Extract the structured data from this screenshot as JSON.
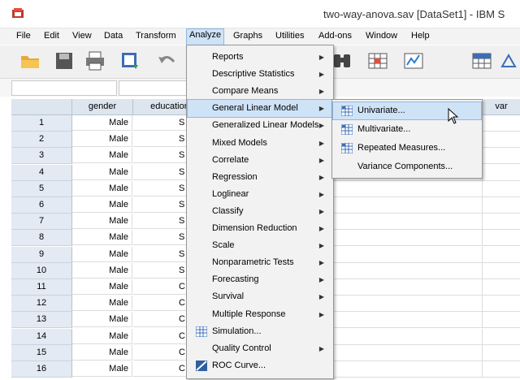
{
  "window": {
    "title": "two-way-anova.sav [DataSet1] - IBM S"
  },
  "menubar": [
    "File",
    "Edit",
    "View",
    "Data",
    "Transform",
    "Analyze",
    "Graphs",
    "Utilities",
    "Add-ons",
    "Window",
    "Help"
  ],
  "grid": {
    "columns": [
      "gender",
      "education",
      "var"
    ],
    "rows": [
      {
        "n": "1",
        "gender": "Male",
        "education": "S"
      },
      {
        "n": "2",
        "gender": "Male",
        "education": "S"
      },
      {
        "n": "3",
        "gender": "Male",
        "education": "S"
      },
      {
        "n": "4",
        "gender": "Male",
        "education": "S"
      },
      {
        "n": "5",
        "gender": "Male",
        "education": "S"
      },
      {
        "n": "6",
        "gender": "Male",
        "education": "S"
      },
      {
        "n": "7",
        "gender": "Male",
        "education": "S"
      },
      {
        "n": "8",
        "gender": "Male",
        "education": "S"
      },
      {
        "n": "9",
        "gender": "Male",
        "education": "S"
      },
      {
        "n": "10",
        "gender": "Male",
        "education": "S"
      },
      {
        "n": "11",
        "gender": "Male",
        "education": "C"
      },
      {
        "n": "12",
        "gender": "Male",
        "education": "C"
      },
      {
        "n": "13",
        "gender": "Male",
        "education": "C"
      },
      {
        "n": "14",
        "gender": "Male",
        "education": "C"
      },
      {
        "n": "15",
        "gender": "Male",
        "education": "C"
      },
      {
        "n": "16",
        "gender": "Male",
        "education": "C"
      }
    ]
  },
  "analyze_menu": [
    {
      "label": "Reports",
      "submenu": true
    },
    {
      "label": "Descriptive Statistics",
      "submenu": true
    },
    {
      "label": "Compare Means",
      "submenu": true
    },
    {
      "label": "General Linear Model",
      "submenu": true,
      "highlighted": true
    },
    {
      "label": "Generalized Linear Models",
      "submenu": true
    },
    {
      "label": "Mixed Models",
      "submenu": true
    },
    {
      "label": "Correlate",
      "submenu": true
    },
    {
      "label": "Regression",
      "submenu": true
    },
    {
      "label": "Loglinear",
      "submenu": true
    },
    {
      "label": "Classify",
      "submenu": true
    },
    {
      "label": "Dimension Reduction",
      "submenu": true
    },
    {
      "label": "Scale",
      "submenu": true
    },
    {
      "label": "Nonparametric Tests",
      "submenu": true
    },
    {
      "label": "Forecasting",
      "submenu": true
    },
    {
      "label": "Survival",
      "submenu": true
    },
    {
      "label": "Multiple Response",
      "submenu": true
    },
    {
      "label": "Simulation...",
      "submenu": false,
      "icon": "simulation-icon"
    },
    {
      "label": "Quality Control",
      "submenu": true
    },
    {
      "label": "ROC Curve...",
      "submenu": false,
      "icon": "roc-curve-icon"
    }
  ],
  "glm_submenu": [
    {
      "label": "Univariate...",
      "icon": "univariate-icon",
      "highlighted": true
    },
    {
      "label": "Multivariate...",
      "icon": "multivariate-icon"
    },
    {
      "label": "Repeated Measures...",
      "icon": "repeated-measures-icon"
    },
    {
      "label": "Variance Components...",
      "icon": ""
    }
  ],
  "colors": {
    "highlight": "#cfe3f7",
    "highlight_border": "#8fb7e0",
    "header": "#dde5ef"
  }
}
